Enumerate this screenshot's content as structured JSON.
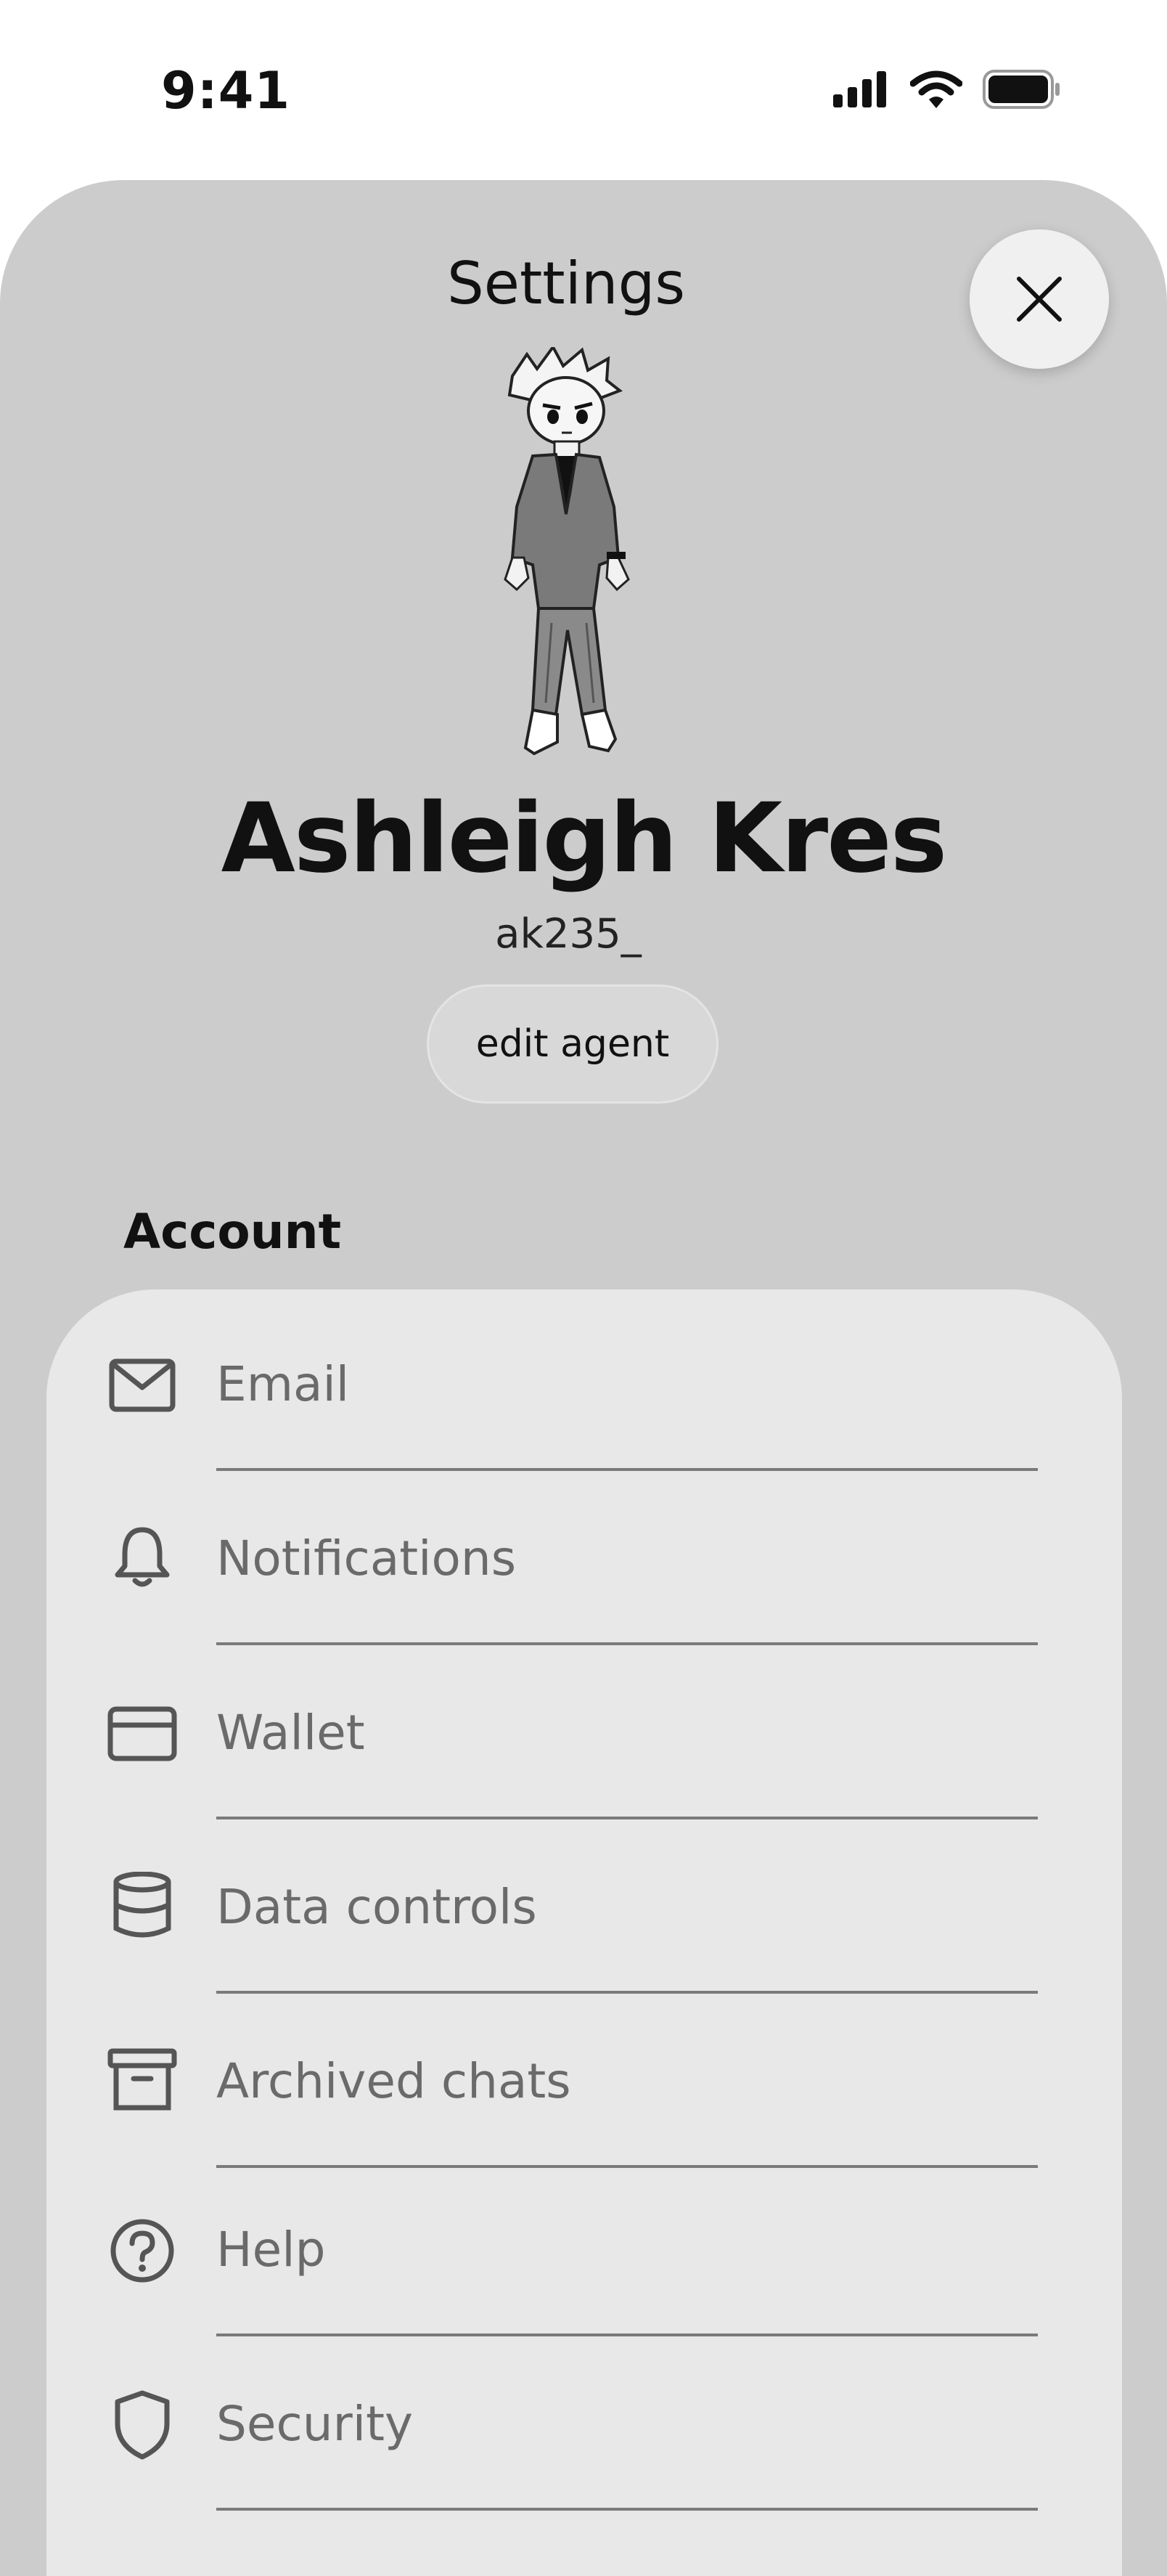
{
  "status_bar": {
    "time": "9:41",
    "icons": [
      "signal-icon",
      "wifi-icon",
      "battery-icon"
    ]
  },
  "header": {
    "title": "Settings",
    "close_icon": "close-icon"
  },
  "profile": {
    "name": "Ashleigh Kres",
    "handle": "ak235_",
    "edit_label": "edit agent"
  },
  "account": {
    "section_title": "Account",
    "items": [
      {
        "label": "Email",
        "icon": "mail-icon"
      },
      {
        "label": "Notifications",
        "icon": "bell-icon"
      },
      {
        "label": "Wallet",
        "icon": "credit-card-icon"
      },
      {
        "label": "Data controls",
        "icon": "database-icon"
      },
      {
        "label": "Archived chats",
        "icon": "archive-icon"
      },
      {
        "label": "Help",
        "icon": "help-icon"
      },
      {
        "label": "Security",
        "icon": "shield-icon"
      }
    ]
  },
  "colors": {
    "sheet_background": "#cccccc",
    "card_background": "#e8e8e8",
    "row_text": "#6a6a6a",
    "divider": "#7a7a7a"
  }
}
